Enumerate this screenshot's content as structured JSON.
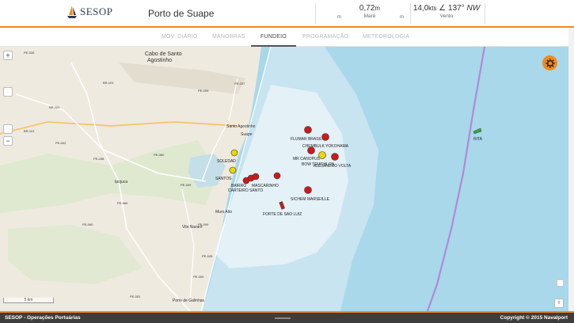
{
  "header": {
    "logo_text": "SESOP",
    "port_title": "Porto de Suape",
    "tide": {
      "value": "0,72",
      "unit": "m",
      "label": "Maré",
      "left_unit": "m",
      "right_unit": "m"
    },
    "wind": {
      "value": "14,0",
      "unit": "kts",
      "angle": "∠ 137°",
      "dir": "NW",
      "label": "Vento"
    }
  },
  "tabs": [
    {
      "label": "MOV. DIÁRIO",
      "active": false
    },
    {
      "label": "MANOBRAS",
      "active": false
    },
    {
      "label": "FUNDEIO",
      "active": true
    },
    {
      "label": "PROGRAMAÇÃO",
      "active": false
    },
    {
      "label": "METEOROLOGIA",
      "active": false
    }
  ],
  "map": {
    "zoom_in": "+",
    "zoom_out": "−",
    "scale_text": "5 km",
    "info": "i",
    "places": [
      {
        "text": "Cabo de Santo"
      },
      {
        "text": "Agostinho"
      },
      {
        "text": "Suape"
      },
      {
        "text": "Santo Agostinho"
      },
      {
        "text": "Ipojuca"
      },
      {
        "text": "Porto de Galinhas"
      },
      {
        "text": "Vila Nazaré"
      },
      {
        "text": "Muro Alto"
      }
    ],
    "roads": [
      "PE-039",
      "BR-101",
      "BR-101",
      "BR-101",
      "PE-042",
      "PE-060",
      "PE-060",
      "PE-038",
      "PE-009",
      "PE-009",
      "PE-037",
      "PE-028",
      "PE-009",
      "PE-051",
      "PE-060",
      "PE-009"
    ],
    "vessels": [
      {
        "name": "FLUMAR BRASIL",
        "color": "#cc1a1a"
      },
      {
        "name": "CHEMBULK YOKOHAMA",
        "color": "#cc1a1a"
      },
      {
        "name": "MR CANOPUS",
        "color": "#cc1a1a"
      },
      {
        "name": "BOW TRIATHLON",
        "color": "#e8d800"
      },
      {
        "name": "ALEJANDRO VOLTA",
        "color": "#cc1a1a"
      },
      {
        "name": "SICHEM MARSEILLE",
        "color": "#cc1a1a"
      },
      {
        "name": "FORTE DE SAO LUIZ",
        "color": "#cc1a1a"
      },
      {
        "name": "RITA",
        "color": "#3aa63a"
      },
      {
        "name": "SOLEDAD",
        "color": "#e8d800"
      },
      {
        "name": "SANTOS",
        "color": "#e8d800"
      },
      {
        "name": "BAIRRO",
        "color": "#cc1a1a"
      },
      {
        "name": "MASCARINHO",
        "color": "#cc1a1a"
      },
      {
        "name": "CARTEIRO SANTO",
        "color": "#cc1a1a"
      }
    ]
  },
  "footer": {
    "left": "SESOP - Operações Portuárias",
    "right": "Copyright © 2015 Navalport"
  },
  "colors": {
    "accent": "#f08a1c",
    "sea": "#a8d8ea",
    "anchorage": "#dcedf5",
    "land": "#efeae0"
  }
}
